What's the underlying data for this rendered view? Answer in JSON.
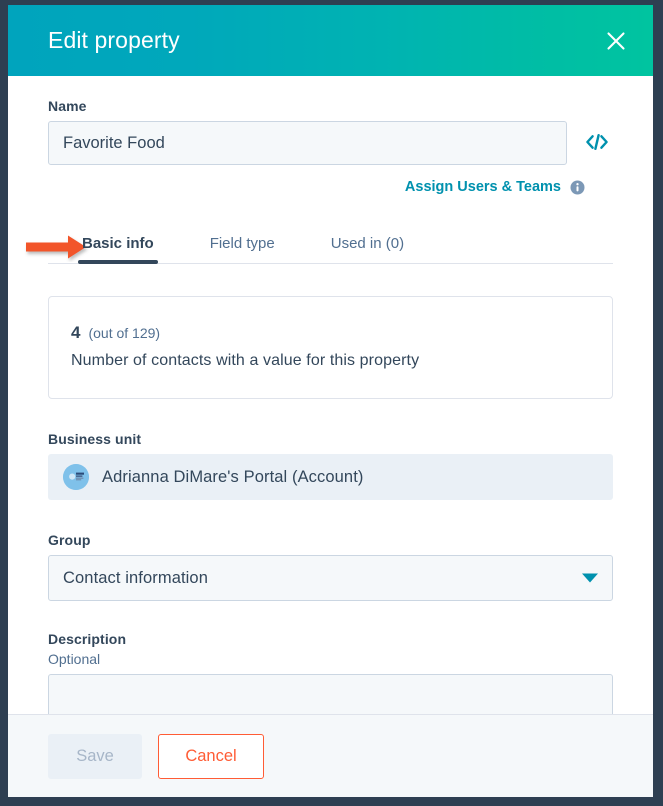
{
  "window": {
    "title": "Edit property",
    "close_icon": "close-icon",
    "header_gradient_from": "#00a4bd",
    "header_gradient_to": "#00c4a0",
    "frame_color": "#2e3f52"
  },
  "name_field": {
    "label": "Name",
    "value": "Favorite Food",
    "placeholder": "",
    "code_icon": "code-brackets-icon"
  },
  "assign": {
    "link_label": "Assign Users & Teams",
    "info_icon": "info-circle-icon",
    "link_color": "#0091ae"
  },
  "tabs": {
    "items": [
      {
        "label": "Basic info",
        "active": true
      },
      {
        "label": "Field type",
        "active": false
      },
      {
        "label": "Used in (0)",
        "active": false
      }
    ],
    "active_underline_color": "#33475b",
    "annotation": {
      "icon": "arrow-right-annotation",
      "color": "#f2552c",
      "points_to": "Basic info"
    }
  },
  "stat_card": {
    "count": "4",
    "total": "(out of 129)",
    "description": "Number of contacts with a value for this property"
  },
  "business_unit": {
    "label": "Business unit",
    "avatar_icon": "portal-avatar-icon",
    "value": "Adrianna DiMare's Portal (Account)"
  },
  "group": {
    "label": "Group",
    "value": "Contact information",
    "caret_icon": "chevron-down-icon",
    "caret_color": "#0091ae",
    "options": [
      "Contact information"
    ]
  },
  "description": {
    "label": "Description",
    "sublabel": "Optional",
    "value": "",
    "placeholder": ""
  },
  "footer": {
    "save_label": "Save",
    "save_disabled": true,
    "cancel_label": "Cancel",
    "cancel_color": "#ff5c35"
  }
}
